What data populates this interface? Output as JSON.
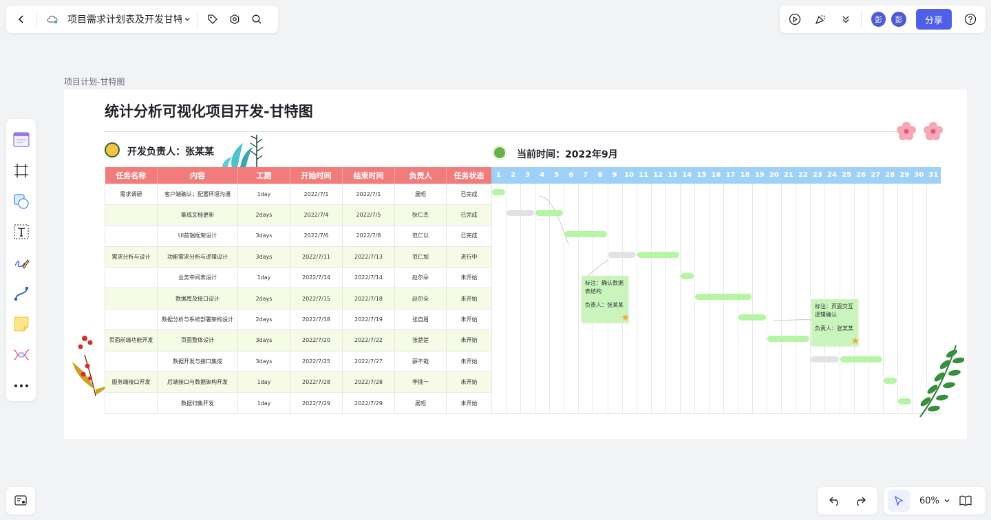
{
  "toolbar": {
    "doc_title": "项目需求计划表及开发甘特图",
    "avatar_1": "彭",
    "avatar_2": "彭",
    "share_label": "分享"
  },
  "zoom": {
    "level": "60%"
  },
  "frame": {
    "label": "项目计划-甘特图"
  },
  "board": {
    "title": "统计分析可视化项目开发-甘特图",
    "owner": "开发负责人：张某某",
    "current_time": "当前时间：2022年9月"
  },
  "table": {
    "headers": [
      "任务名称",
      "内容",
      "工期",
      "开始时间",
      "结束时间",
      "负责人",
      "任务状态"
    ],
    "rows": [
      [
        "需求调研",
        "客户端确认；配置环境沟通",
        "1day",
        "2022/7/1",
        "2022/7/1",
        "展昭",
        "已完成"
      ],
      [
        "",
        "集成文档更新",
        "2days",
        "2022/7/4",
        "2022/7/5",
        "狄仁杰",
        "已完成"
      ],
      [
        "",
        "UI前端框架设计",
        "3days",
        "2022/7/6",
        "2022/7/8",
        "范仁以",
        "已完成"
      ],
      [
        "需求分析与设计",
        "功能需求分析与逻辑设计",
        "3days",
        "2022/7/11",
        "2022/7/13",
        "范仁加",
        "进行中"
      ],
      [
        "",
        "业务中间表设计",
        "1day",
        "2022/7/14",
        "2022/7/14",
        "赵尔朵",
        "未开始"
      ],
      [
        "",
        "数据库及接口设计",
        "2days",
        "2022/7/15",
        "2022/7/18",
        "赵尔朵",
        "未开始"
      ],
      [
        "",
        "数据分析与系统部署架构设计",
        "2days",
        "2022/7/18",
        "2022/7/19",
        "张自眉",
        "未开始"
      ],
      [
        "页面前端功能开发",
        "页面整体设计",
        "3days",
        "2022/7/20",
        "2022/7/22",
        "张楚楚",
        "未开始"
      ],
      [
        "",
        "数据开发与接口集成",
        "3days",
        "2022/7/25",
        "2022/7/27",
        "薛不哉",
        "未开始"
      ],
      [
        "服务端接口开发",
        "后端接口与数据架构开发",
        "1day",
        "2022/7/28",
        "2022/7/28",
        "李挑一",
        "未开始"
      ],
      [
        "",
        "数据归集开发",
        "1day",
        "2022/7/29",
        "2022/7/29",
        "展昭",
        "未开始"
      ]
    ]
  },
  "gantt": {
    "days": [
      "1",
      "2",
      "3",
      "4",
      "5",
      "6",
      "7",
      "8",
      "9",
      "10",
      "11",
      "12",
      "13",
      "14",
      "15",
      "16",
      "17",
      "18",
      "19",
      "20",
      "21",
      "22",
      "23",
      "24",
      "25",
      "26",
      "27",
      "28",
      "29",
      "30",
      "31"
    ],
    "bars": [
      {
        "row": 0,
        "start": 1,
        "end": 1,
        "kind": "done"
      },
      {
        "row": 1,
        "start": 2,
        "end": 3,
        "kind": "grey"
      },
      {
        "row": 1,
        "start": 4,
        "end": 5,
        "kind": "done"
      },
      {
        "row": 2,
        "start": 6,
        "end": 8,
        "kind": "done"
      },
      {
        "row": 3,
        "start": 9,
        "end": 10,
        "kind": "grey"
      },
      {
        "row": 3,
        "start": 11,
        "end": 13,
        "kind": "done"
      },
      {
        "row": 4,
        "start": 14,
        "end": 14,
        "kind": "done"
      },
      {
        "row": 5,
        "start": 15,
        "end": 18,
        "kind": "done"
      },
      {
        "row": 6,
        "start": 18,
        "end": 19,
        "kind": "done"
      },
      {
        "row": 7,
        "start": 20,
        "end": 22,
        "kind": "done"
      },
      {
        "row": 8,
        "start": 23,
        "end": 24,
        "kind": "grey"
      },
      {
        "row": 8,
        "start": 25,
        "end": 27,
        "kind": "done"
      },
      {
        "row": 9,
        "start": 28,
        "end": 28,
        "kind": "done"
      },
      {
        "row": 10,
        "start": 29,
        "end": 29,
        "kind": "done"
      }
    ],
    "colors": {
      "done": "#b6f5a4",
      "grey": "#e2e2e2"
    },
    "note1": {
      "line1": "标注：确认数据",
      "line2": "表结构",
      "line3": "负责人：张某某"
    },
    "note2": {
      "line1": "标注：页面交互",
      "line2": "逻辑确认",
      "line3": "负责人：张某某"
    }
  }
}
